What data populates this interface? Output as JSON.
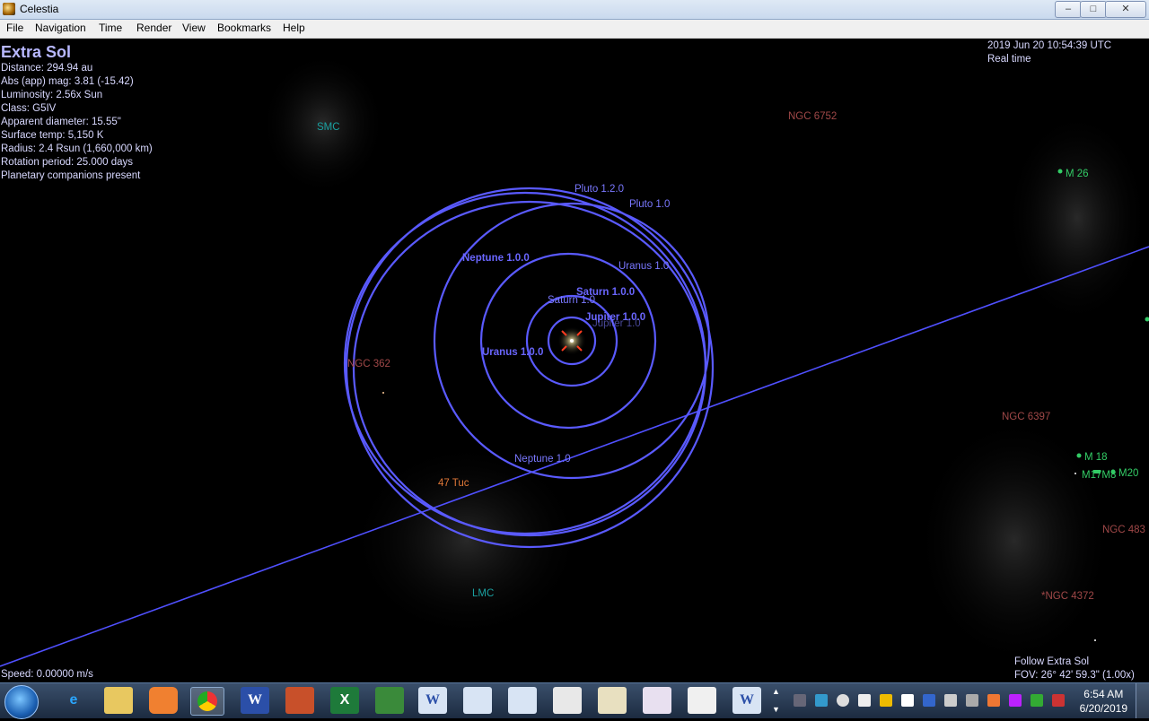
{
  "window": {
    "title": "Celestia",
    "controls": [
      "–",
      "□",
      "✕"
    ]
  },
  "menu": [
    "File",
    "Navigation",
    "Time",
    "Render",
    "View",
    "Bookmarks",
    "Help"
  ],
  "info": {
    "name": "Extra Sol",
    "lines": [
      "Distance: 294.94 au",
      "Abs (app) mag: 3.81 (-15.42)",
      "Luminosity: 2.56x Sun",
      "Class: G5IV",
      "Apparent diameter: 15.55\"",
      "Surface temp: 5,150 K",
      "Radius: 2.4 Rsun  (1,660,000 km)",
      "Rotation period: 25.000 days",
      "Planetary companions present"
    ]
  },
  "time": {
    "date": "2019 Jun 20 10:54:39 UTC",
    "mode": "Real time"
  },
  "status": {
    "speed": "Speed: 0.00000 m/s",
    "follow": "Follow Extra Sol",
    "fov": "FOV: 26° 42' 59.3\" (1.00x)"
  },
  "labels": {
    "smc": "SMC",
    "ngc6752": "NGC 6752",
    "m26": "M 26",
    "ngc362": "NGC 362",
    "ngc6397": "NGC 6397",
    "m18": "M 18",
    "m17m8": "M17M8",
    "m20": "M20",
    "ngc483x": "NGC 483",
    "tuc47": "47 Tuc",
    "lmc": "LMC",
    "ngc4372": "*NGC 4372",
    "pluto_a": "Pluto 1.2.0",
    "pluto_b": "Pluto 1.0",
    "neptune_a": "Neptune 1.0.0",
    "uranus_a": "Uranus 1.0",
    "saturn_a": "Saturn 1.0.0",
    "saturn_b": "Saturn 1.0",
    "jupiter_a": "Jupiter 1.0.0",
    "jupiter_b": "Jupiter 1.0",
    "uranus_b": "Uranus 1.0.0",
    "neptune_b": "Neptune 1.0"
  },
  "taskbar": {
    "clock_time": "6:54 AM",
    "clock_date": "6/20/2019",
    "apps": [
      "start",
      "internet-explorer",
      "file-explorer",
      "media-player",
      "chrome",
      "word",
      "powerpoint",
      "excel",
      "publisher",
      "word-doc",
      "document",
      "document",
      "document",
      "document",
      "document",
      "document",
      "word-doc"
    ]
  },
  "colors": {
    "orbit": "#5a5aff",
    "planet_label": "#7a78ff",
    "nebula_label": "#a04848",
    "galaxy_label": "#1aa0a0",
    "cluster_label": "#33cc66",
    "globular_label": "#e07838"
  }
}
